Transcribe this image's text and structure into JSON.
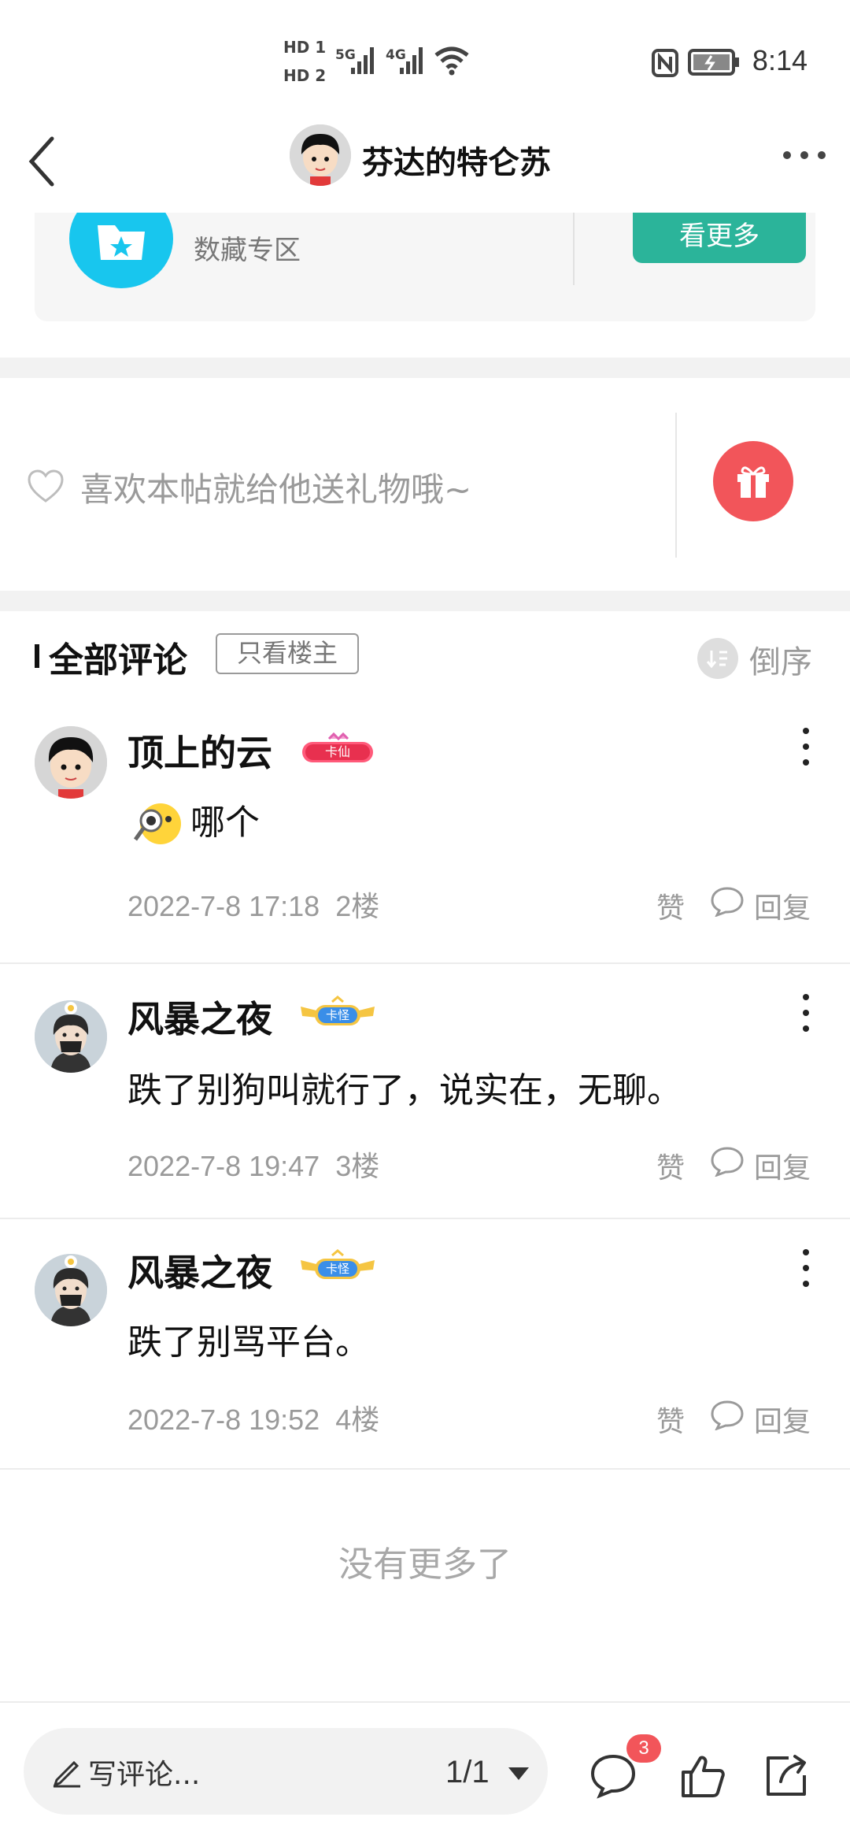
{
  "status_bar": {
    "hd1": "HD 1",
    "hd2": "HD 2",
    "net1": "5G",
    "net2": "4G",
    "time": "8:14"
  },
  "nav": {
    "title": "芬达的特仑苏"
  },
  "collection": {
    "label": "数藏专区",
    "see_more": "看更多"
  },
  "gift": {
    "prompt": "喜欢本帖就给他送礼物哦~"
  },
  "comments_header": {
    "title": "全部评论",
    "only_op": "只看楼主",
    "sort": "倒序"
  },
  "comments": [
    {
      "name": "顶上的云",
      "badge": "卡仙",
      "text": "哪个",
      "time": "2022-7-8 17:18",
      "floor": "2楼",
      "like": "赞",
      "reply": "回复"
    },
    {
      "name": "风暴之夜",
      "badge": "卡怪",
      "text": "跌了别狗叫就行了，说实在，无聊。",
      "time": "2022-7-8 19:47",
      "floor": "3楼",
      "like": "赞",
      "reply": "回复"
    },
    {
      "name": "风暴之夜",
      "badge": "卡怪",
      "text": "跌了别骂平台。",
      "time": "2022-7-8 19:52",
      "floor": "4楼",
      "like": "赞",
      "reply": "回复"
    }
  ],
  "no_more": "没有更多了",
  "bottom_bar": {
    "write_comment": "写评论...",
    "page": "1/1",
    "comment_count": "3"
  },
  "colors": {
    "accent_green": "#2bb49a",
    "gift_red": "#f2555a",
    "collection_blue": "#18c6ee"
  }
}
